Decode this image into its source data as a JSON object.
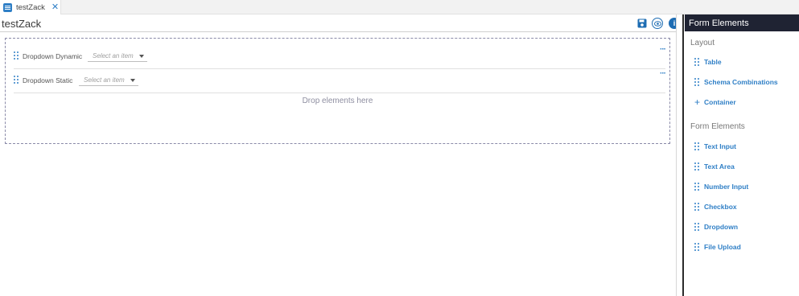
{
  "tab": {
    "label": "testZack",
    "icon": "list-icon",
    "close_icon": "close-icon"
  },
  "header": {
    "title": "testZack",
    "save_icon": "save-icon",
    "preview_icon": "eye-icon",
    "info_icon": "info-icon",
    "info_glyph": "i"
  },
  "canvas": {
    "rows": [
      {
        "label": "Dropdown Dynamic",
        "placeholder": "Select an item"
      },
      {
        "label": "Dropdown Static",
        "placeholder": "Select an item"
      }
    ],
    "more_glyph": "···",
    "drop_text": "Drop elements here"
  },
  "panel": {
    "title": "Form Elements",
    "sections": [
      {
        "title": "Layout",
        "items": [
          "Table",
          "Schema Combinations",
          "Container"
        ]
      },
      {
        "title": "Form Elements",
        "items": [
          "Text Input",
          "Text Area",
          "Number Input",
          "Checkbox",
          "Dropdown",
          "File Upload"
        ]
      }
    ]
  },
  "colors": {
    "accent": "#2f7fc6",
    "panel_header": "#1f2333",
    "dashed_border": "#8a8aa8"
  }
}
